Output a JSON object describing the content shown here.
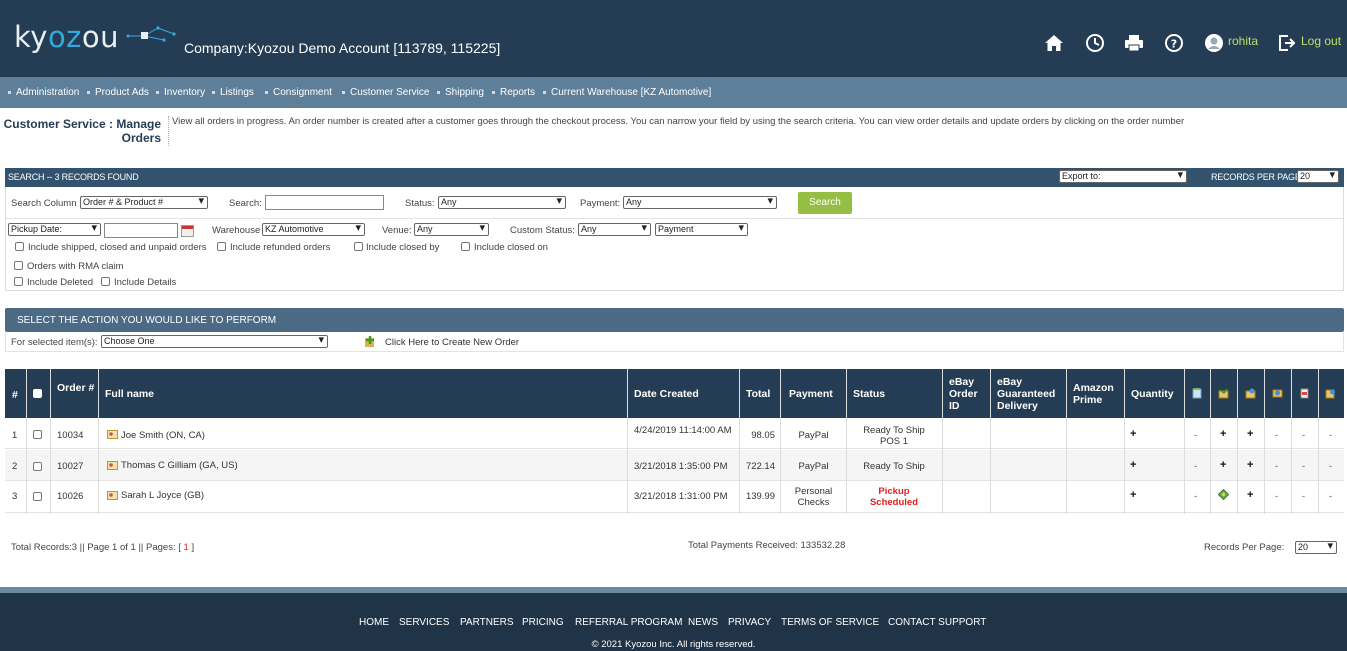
{
  "header": {
    "logo": {
      "part1": "ky",
      "part2": "oz",
      "part3": "ou"
    },
    "company": "Company:Kyozou Demo Account [113789,  115225]",
    "username": "rohita",
    "logout": "Log out"
  },
  "nav": [
    "Administration",
    "Product Ads",
    "Inventory",
    "Listings",
    "Consignment",
    "Customer Service",
    "Shipping",
    "Reports",
    "Current Warehouse [KZ Automotive]"
  ],
  "page": {
    "title": "Customer Service : Manage Orders",
    "description": "View all orders in progress. An order number is created after a customer goes through the checkout process. You can narrow your field by using the search criteria. You can view order details and update orders by clicking on the order number"
  },
  "search": {
    "bar_label": "SEARCH -- 3 RECORDS FOUND",
    "export_value": "Export to:",
    "records_per_page_label": "RECORDS PER PAGE:",
    "records_per_page_value": "20",
    "search_column_label": "Search Column",
    "search_column_value": "Order # & Product #",
    "search_label": "Search:",
    "search_value": "",
    "status_label": "Status:",
    "status_value": "Any",
    "payment_label": "Payment:",
    "payment_value": "Any",
    "search_button": "Search",
    "pickup_date_value": "Pickup Date:",
    "date_value": "",
    "warehouse_label": "Warehouse",
    "warehouse_value": "KZ Automotive",
    "venue_label": "Venue:",
    "venue_value": "Any",
    "custom_status_label": "Custom Status:",
    "custom_status_value": "Any",
    "custom_payment_value": "Payment",
    "checkboxes": {
      "shipped": "Include shipped, closed and unpaid orders",
      "refunded": "Include refunded orders",
      "closed_by": "Include closed by",
      "closed_on": "Include closed on",
      "rma": "Orders with RMA claim",
      "deleted": "Include Deleted",
      "details": "Include Details"
    }
  },
  "action": {
    "bar_label": "SELECT THE ACTION YOU WOULD LIKE TO PERFORM",
    "selected_label": "For selected item(s):",
    "selected_value": "Choose One",
    "create_order": "Click Here to Create New Order"
  },
  "table": {
    "headers": {
      "num": "#",
      "order": "Order #",
      "full_name": "Full name",
      "date_created": "Date Created",
      "total": "Total",
      "payment": "Payment",
      "status": "Status",
      "ebay_order_id": "eBay Order ID",
      "ebay_guaranteed": "eBay Guaranteed Delivery",
      "amazon_prime": "Amazon Prime",
      "quantity": "Quantity"
    },
    "rows": [
      {
        "num": "1",
        "order": "10034",
        "name": "Joe Smith (ON, CA)",
        "date": "4/24/2019 11:14:00 AM",
        "total": "98.05",
        "payment": "PayPal",
        "status": "Ready To Ship POS 1",
        "qty": "+",
        "c1": "-",
        "c2": "+",
        "c3": "+",
        "c4": "-",
        "c5": "-",
        "c6": "-"
      },
      {
        "num": "2",
        "order": "10027",
        "name": "Thomas C Gilliam (GA, US)",
        "date": "3/21/2018 1:35:00 PM",
        "total": "722.14",
        "payment": "PayPal",
        "status": "Ready To Ship",
        "qty": "+",
        "c1": "-",
        "c2": "+",
        "c3": "+",
        "c4": "-",
        "c5": "-",
        "c6": "-"
      },
      {
        "num": "3",
        "order": "10026",
        "name": "Sarah L Joyce (GB)",
        "date": "3/21/2018 1:31:00 PM",
        "total": "139.99",
        "payment": "Personal Checks",
        "status": "Pickup Scheduled",
        "qty": "+",
        "c1": "-",
        "c2": "",
        "c3": "+",
        "c4": "-",
        "c5": "-",
        "c6": "-"
      }
    ]
  },
  "summary": {
    "total_records": "Total Records:3 || Page 1 of 1 || Pages: [",
    "page": "1",
    "close": "]",
    "payments": "Total Payments Received: 133532.28",
    "rpp_label": "Records Per Page:",
    "rpp_value": "20"
  },
  "footer": {
    "links": [
      "HOME",
      "SERVICES",
      "PARTNERS",
      "PRICING",
      "REFERRAL PROGRAM",
      "NEWS",
      "PRIVACY",
      "TERMS OF SERVICE",
      "CONTACT SUPPORT"
    ],
    "copyright": "© 2021 Kyozou Inc. All rights reserved."
  },
  "colors": {
    "header_bg": "#243d54",
    "nav_bg": "#5d7f99",
    "accent_green": "#96bd44",
    "status_red": "#e02020"
  }
}
